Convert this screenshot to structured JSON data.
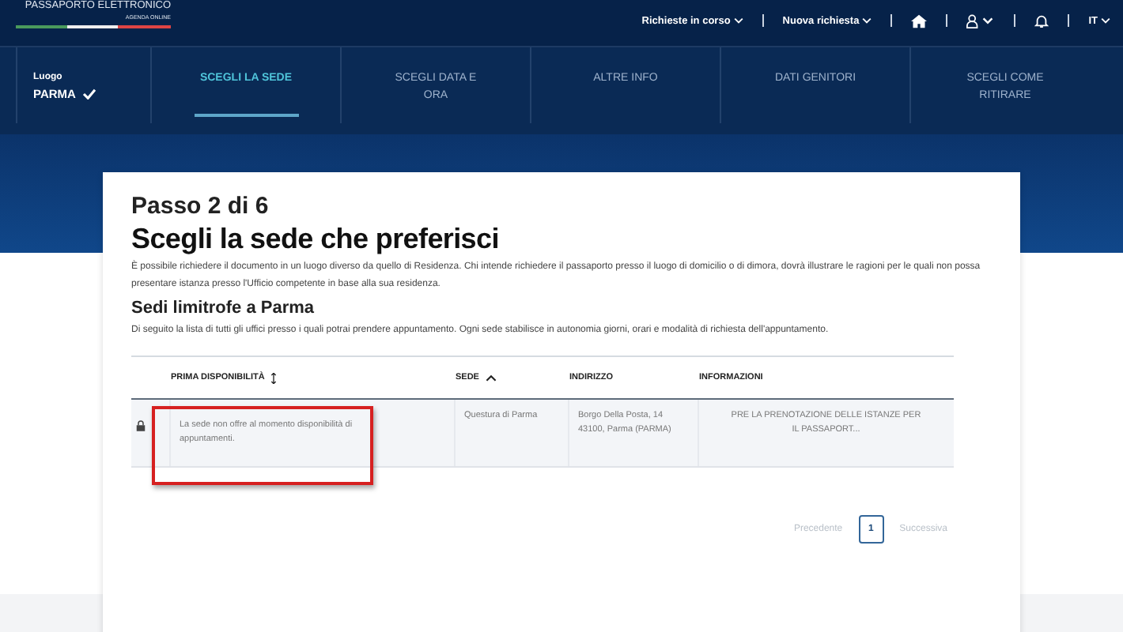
{
  "header": {
    "logo_title": "PASSAPORTO ELETTRONICO",
    "logo_subtitle": "AGENDA ONLINE",
    "menus": [
      {
        "label": "Richieste in corso",
        "dropdown": true
      },
      {
        "label": "Nuova richiesta",
        "dropdown": true
      }
    ],
    "language": "IT"
  },
  "steps": [
    {
      "label": "Luogo",
      "value": "PARMA",
      "completed": true,
      "selected": false
    },
    {
      "label": "SCEGLI LA SEDE",
      "completed": false,
      "selected": true
    },
    {
      "label": "SCEGLI DATA E ORA",
      "completed": false,
      "selected": false
    },
    {
      "label": "ALTRE INFO",
      "completed": false,
      "selected": false
    },
    {
      "label": "DATI GENITORI",
      "completed": false,
      "selected": false
    },
    {
      "label": "SCEGLI COME RITIRARE",
      "completed": false,
      "selected": false
    }
  ],
  "card": {
    "step": "Passo 2 di 6",
    "title": "Scegli la sede che preferisci",
    "intro": "È possibile richiedere il documento in un luogo diverso da quello di Residenza. Chi intende richiedere il passaporto presso il luogo di domicilio o di dimora, dovrà illustrare le ragioni per le quali non possa presentare istanza presso l'Ufficio competente in base alla sua residenza.",
    "subtitle": "Sedi limitrofe a Parma",
    "description": "Di seguito la lista di tutti gli uffici presso i quali potrai prendere appuntamento. Ogni sede stabilisce in autonomia giorni, orari e modalità di richiesta dell'appuntamento."
  },
  "table": {
    "columns": [
      {
        "label": "PRIMA DISPONIBILITÀ",
        "sortable": true
      },
      {
        "label": "SEDE",
        "sortable": true,
        "sorted_ascending": true
      },
      {
        "label": "INDIRIZZO",
        "sortable": false
      },
      {
        "label": "INFORMAZIONI",
        "sortable": false
      }
    ],
    "rows": [
      {
        "locked": true,
        "highlighted": true,
        "cells": [
          "La sede non offre al momento disponibilità di appuntamenti.",
          "Questura di Parma",
          "Borgo Della Posta, 14 43100, Parma (PARMA)",
          "PRE LA PRENOTAZIONE DELLE ISTANZE PER IL PASSAPORT..."
        ]
      }
    ]
  },
  "pagination": {
    "previous": {
      "label": "Precedente",
      "disabled": true
    },
    "pages": [
      {
        "label": "1",
        "selected": true
      }
    ],
    "next": {
      "label": "Successiva",
      "disabled": true
    }
  }
}
